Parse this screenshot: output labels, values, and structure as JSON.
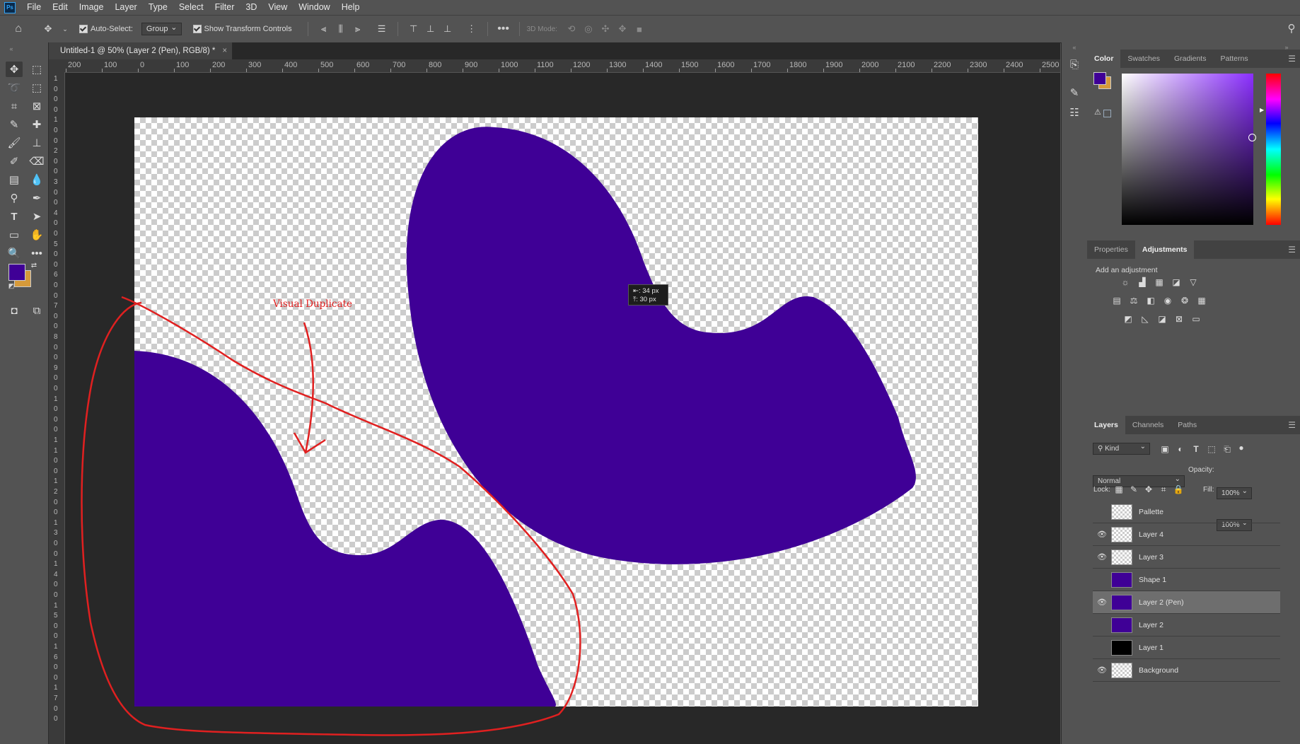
{
  "menu": {
    "logo": "Ps",
    "items": [
      "File",
      "Edit",
      "Image",
      "Layer",
      "Type",
      "Select",
      "Filter",
      "3D",
      "View",
      "Window",
      "Help"
    ]
  },
  "options": {
    "auto_select_label": "Auto-Select:",
    "auto_select_value": "Group",
    "show_transform_label": "Show Transform Controls",
    "mode_3d_label": "3D Mode:"
  },
  "document": {
    "tab_title": "Untitled-1 @ 50% (Layer 2 (Pen), RGB/8) *",
    "tab_close": "×",
    "ruler_h": [
      "200",
      "100",
      "0",
      "100",
      "200",
      "300",
      "400",
      "500",
      "600",
      "700",
      "800",
      "900",
      "1000",
      "1100",
      "1200",
      "1300",
      "1400",
      "1500",
      "1600",
      "1700",
      "1800",
      "1900",
      "2000",
      "2100",
      "2200",
      "2300",
      "2400",
      "2500"
    ],
    "ruler_v": [
      "1",
      "0",
      "0",
      "0",
      "1",
      "0",
      "0",
      "2",
      "0",
      "0",
      "3",
      "0",
      "0",
      "4",
      "0",
      "0",
      "5",
      "0",
      "0",
      "6",
      "0",
      "0",
      "7",
      "0",
      "0",
      "8",
      "0",
      "0",
      "9",
      "0",
      "0",
      "1",
      "0",
      "0",
      "0",
      "1",
      "1",
      "0",
      "0",
      "1",
      "2",
      "0",
      "0",
      "1",
      "3",
      "0",
      "0",
      "1",
      "4",
      "0",
      "0",
      "1",
      "5",
      "0",
      "0",
      "1",
      "6",
      "0",
      "0",
      "1",
      "7",
      "0",
      "0"
    ],
    "shape_color": "#3f0096",
    "tooltip_w": "⇤: 34 px",
    "tooltip_h": "⤒: 30 px",
    "annotation_label": "Visual Duplicate",
    "annotation_color": "#e02020"
  },
  "colors": {
    "foreground": "#3f0096",
    "background": "#d69a3a"
  },
  "color_panel": {
    "tabs": [
      "Color",
      "Swatches",
      "Gradients",
      "Patterns"
    ],
    "active_tab": "Color"
  },
  "adjust_panel": {
    "tabs": [
      "Properties",
      "Adjustments"
    ],
    "active_tab": "Adjustments",
    "hint": "Add an adjustment"
  },
  "layers_panel": {
    "tabs": [
      "Layers",
      "Channels",
      "Paths"
    ],
    "active_tab": "Layers",
    "filter_label": "Kind",
    "blend_mode": "Normal",
    "opacity_label": "Opacity:",
    "opacity_value": "100%",
    "lock_label": "Lock:",
    "fill_label": "Fill:",
    "fill_value": "100%",
    "layers": [
      {
        "name": "Pallette",
        "visible": false,
        "thumb": "checker",
        "selected": false
      },
      {
        "name": "Layer 4",
        "visible": true,
        "thumb": "checker",
        "selected": false
      },
      {
        "name": "Layer 3",
        "visible": true,
        "thumb": "checker",
        "selected": false
      },
      {
        "name": "Shape 1",
        "visible": false,
        "thumb": "purple",
        "selected": false
      },
      {
        "name": "Layer 2 (Pen)",
        "visible": true,
        "thumb": "purple",
        "selected": true
      },
      {
        "name": "Layer 2",
        "visible": false,
        "thumb": "purple",
        "selected": false
      },
      {
        "name": "Layer 1",
        "visible": false,
        "thumb": "black",
        "selected": false
      },
      {
        "name": "Background",
        "visible": true,
        "thumb": "checker",
        "selected": false
      }
    ]
  }
}
